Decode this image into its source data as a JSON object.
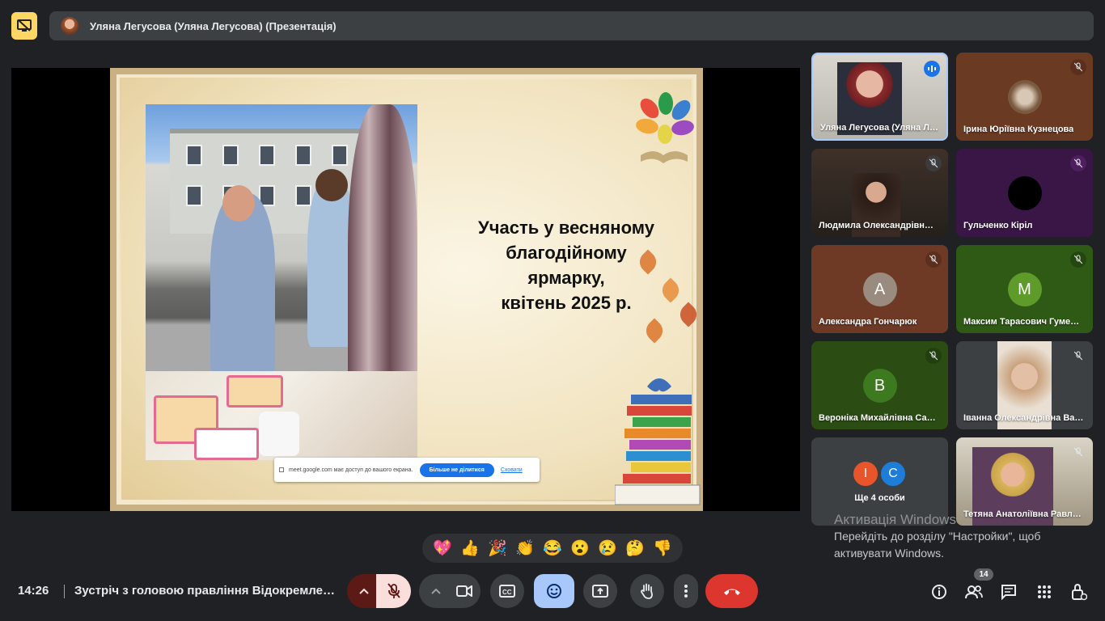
{
  "top": {
    "title": "Уляна Легусова (Уляна Легусова) (Презентація)"
  },
  "slide": {
    "text_lines": [
      "Участь у весняному",
      "благодійному",
      "ярмарку,",
      "квітень 2025 р."
    ]
  },
  "share_notice": {
    "text": "meet.google.com має доступ до вашого екрана.",
    "stop_button": "Більше не ділитися",
    "hide_link": "Сховати"
  },
  "participants": [
    {
      "name": "Уляна Легусова (Уляна Л…",
      "state": "speaking"
    },
    {
      "name": "Ірина Юріївна Кузнецова",
      "state": "muted"
    },
    {
      "name": "Людмила Олександрівн…",
      "state": "muted"
    },
    {
      "name": "Гульченко Кіріл",
      "state": "muted"
    },
    {
      "name": "Александра Гончарюк",
      "initial": "А",
      "state": "muted"
    },
    {
      "name": "Максим Тарасович Гуме…",
      "initial": "М",
      "state": "muted"
    },
    {
      "name": "Вероніка Михайлівна Са…",
      "initial": "В",
      "state": "muted"
    },
    {
      "name": "Іванна Олександрівна Ва…",
      "state": "muted"
    },
    {
      "name": "Тетяна Анатоліївна Равл…",
      "state": "muted"
    }
  ],
  "others": {
    "initials": [
      "І",
      "С"
    ],
    "label": "Ще 4 особи"
  },
  "windows_activation": {
    "title": "Активація Windows",
    "line1": "Перейдіть до розділу \"Настройки\", щоб",
    "line2": "активувати Windows."
  },
  "reactions": [
    "💖",
    "👍",
    "🎉",
    "👏",
    "😂",
    "😮",
    "😢",
    "🤔",
    "👎"
  ],
  "bottom": {
    "time": "14:26",
    "meeting_title": "Зустріч з головою правління Відокремленого …",
    "people_count": "14"
  },
  "colors": {
    "present_accent": "#fdd663",
    "end_call": "#ea4335",
    "mic_off_bg": "#f9dedc",
    "active_btn": "#a8c7fa"
  },
  "icons": [
    "present-to-all-icon",
    "chevron-up-icon",
    "mic-off-icon",
    "camera-icon",
    "captions-icon",
    "emoji-icon",
    "present-icon",
    "raise-hand-icon",
    "more-vert-icon",
    "end-call-icon",
    "info-icon",
    "people-icon",
    "chat-icon",
    "activities-icon",
    "host-controls-icon"
  ]
}
